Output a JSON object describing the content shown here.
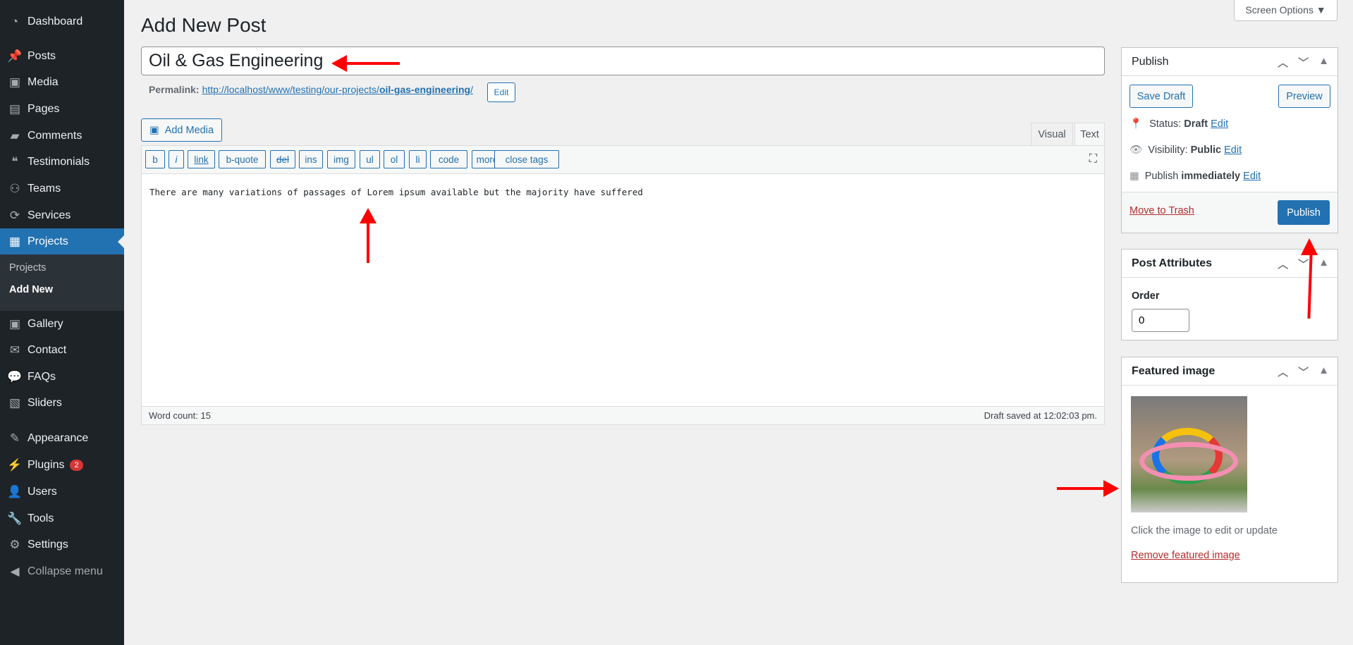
{
  "sidebar": {
    "items": [
      {
        "label": "Dashboard",
        "icon": "dashboard-icon"
      },
      {
        "label": "Posts",
        "icon": "pin-icon"
      },
      {
        "label": "Media",
        "icon": "media-icon"
      },
      {
        "label": "Pages",
        "icon": "pages-icon"
      },
      {
        "label": "Comments",
        "icon": "comment-icon"
      },
      {
        "label": "Testimonials",
        "icon": "testimonial-icon"
      },
      {
        "label": "Teams",
        "icon": "groups-icon"
      },
      {
        "label": "Services",
        "icon": "update-icon"
      },
      {
        "label": "Projects",
        "icon": "layout-icon",
        "active": true
      },
      {
        "label": "Gallery",
        "icon": "gallery-icon"
      },
      {
        "label": "Contact",
        "icon": "email-icon"
      },
      {
        "label": "FAQs",
        "icon": "chat-icon"
      },
      {
        "label": "Sliders",
        "icon": "slides-icon"
      },
      {
        "label": "Appearance",
        "icon": "brush-icon"
      },
      {
        "label": "Plugins",
        "icon": "plugin-icon",
        "badge": "2"
      },
      {
        "label": "Users",
        "icon": "user-icon"
      },
      {
        "label": "Tools",
        "icon": "wrench-icon"
      },
      {
        "label": "Settings",
        "icon": "settings-icon"
      }
    ],
    "submenu": [
      "Projects",
      "Add New"
    ],
    "collapse": "Collapse menu"
  },
  "header": {
    "title": "Add New Post",
    "screen_options": "Screen Options ▼"
  },
  "editor": {
    "post_title": "Oil & Gas Engineering",
    "permalink_label": "Permalink:",
    "permalink_base": "http://localhost/www/testing/our-projects/",
    "permalink_slug": "oil-gas-engineering",
    "permalink_end": "/",
    "permalink_edit": "Edit",
    "add_media": "Add Media",
    "tabs": [
      "Visual",
      "Text"
    ],
    "active_tab": "Text",
    "quicktags": [
      "b",
      "i",
      "link",
      "b-quote",
      "del",
      "ins",
      "img",
      "ul",
      "ol",
      "li",
      "code",
      "more",
      "close tags"
    ],
    "content": "There are many variations of passages of Lorem ipsum available but the majority have suffered",
    "word_count": "Word count: 15",
    "draft_saved": "Draft saved at 12:02:03 pm."
  },
  "publish": {
    "title": "Publish",
    "save_draft": "Save Draft",
    "preview": "Preview",
    "status_label": "Status:",
    "status": "Draft",
    "visibility_label": "Visibility:",
    "visibility": "Public",
    "publish_label": "Publish",
    "publish_when": "immediately",
    "edit": "Edit",
    "trash": "Move to Trash",
    "publish_button": "Publish"
  },
  "attributes": {
    "title": "Post Attributes",
    "order_label": "Order",
    "order_value": "0"
  },
  "featured": {
    "title": "Featured image",
    "hint": "Click the image to edit or update",
    "remove": "Remove featured image"
  },
  "colors": {
    "accent": "#2271b1",
    "sidebar": "#1d2327",
    "annotation": "#ff0000",
    "danger": "#b32d2e"
  }
}
